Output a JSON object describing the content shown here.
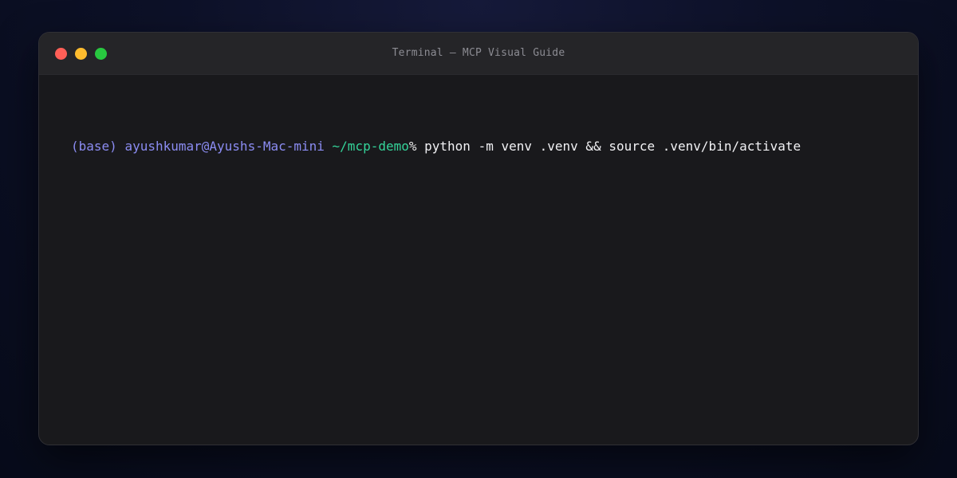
{
  "window": {
    "title": "Terminal — MCP Visual Guide",
    "controls": {
      "close": "close-icon",
      "minimize": "minimize-icon",
      "maximize": "maximize-icon"
    }
  },
  "terminal": {
    "prompt": {
      "env": "(base)",
      "user_host": "ayushkumar@Ayushs-Mac-mini",
      "cwd": "~/mcp-demo",
      "symbol": "%"
    },
    "command": "python -m venv .venv && source .venv/bin/activate"
  },
  "colors": {
    "prompt_user": "#8b8cf2",
    "prompt_cwd": "#34d399",
    "command_text": "#f1f1f4",
    "background": "#19191c",
    "titlebar": "#252528",
    "close": "#ff5f57",
    "minimize": "#febc2e",
    "maximize": "#28c840"
  }
}
